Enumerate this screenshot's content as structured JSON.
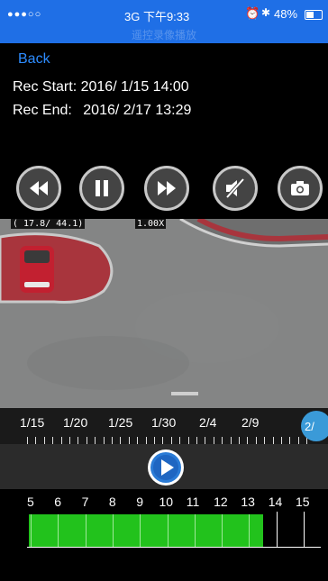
{
  "status": {
    "carrier_dots": "●●●○○",
    "network_time": "3G 下午9:33",
    "alarm_icon": "⏰",
    "bt_icon": "✱",
    "battery": "48%",
    "faded_title": "遥控录像播放"
  },
  "nav": {
    "back_label": "Back"
  },
  "recording": {
    "start_label": "Rec Start:",
    "start_value": "2016/ 1/15 14:00",
    "end_label": "Rec End:",
    "end_value": "2016/ 2/17 13:29"
  },
  "controls": {
    "rewind_icon": "rewind-icon",
    "pause_icon": "pause-icon",
    "forward_icon": "fast-forward-icon",
    "mute_icon": "mute-icon",
    "snapshot_icon": "camera-icon"
  },
  "video": {
    "osd_coords": "( 17.8/ 44.1)",
    "osd_zoom": "1.00X"
  },
  "date_timeline": {
    "labels": [
      "1/15",
      "1/20",
      "1/25",
      "1/30",
      "2/4",
      "2/9"
    ],
    "handle_label": "2/"
  },
  "hour_timeline": {
    "labels": [
      "5",
      "6",
      "7",
      "8",
      "9",
      "10",
      "11",
      "12",
      "13",
      "14",
      "15"
    ],
    "recorded_color": "#22c21c"
  },
  "colors": {
    "accent": "#1f6fe6",
    "link": "#2d8cff",
    "handle": "#3a9ad8"
  }
}
